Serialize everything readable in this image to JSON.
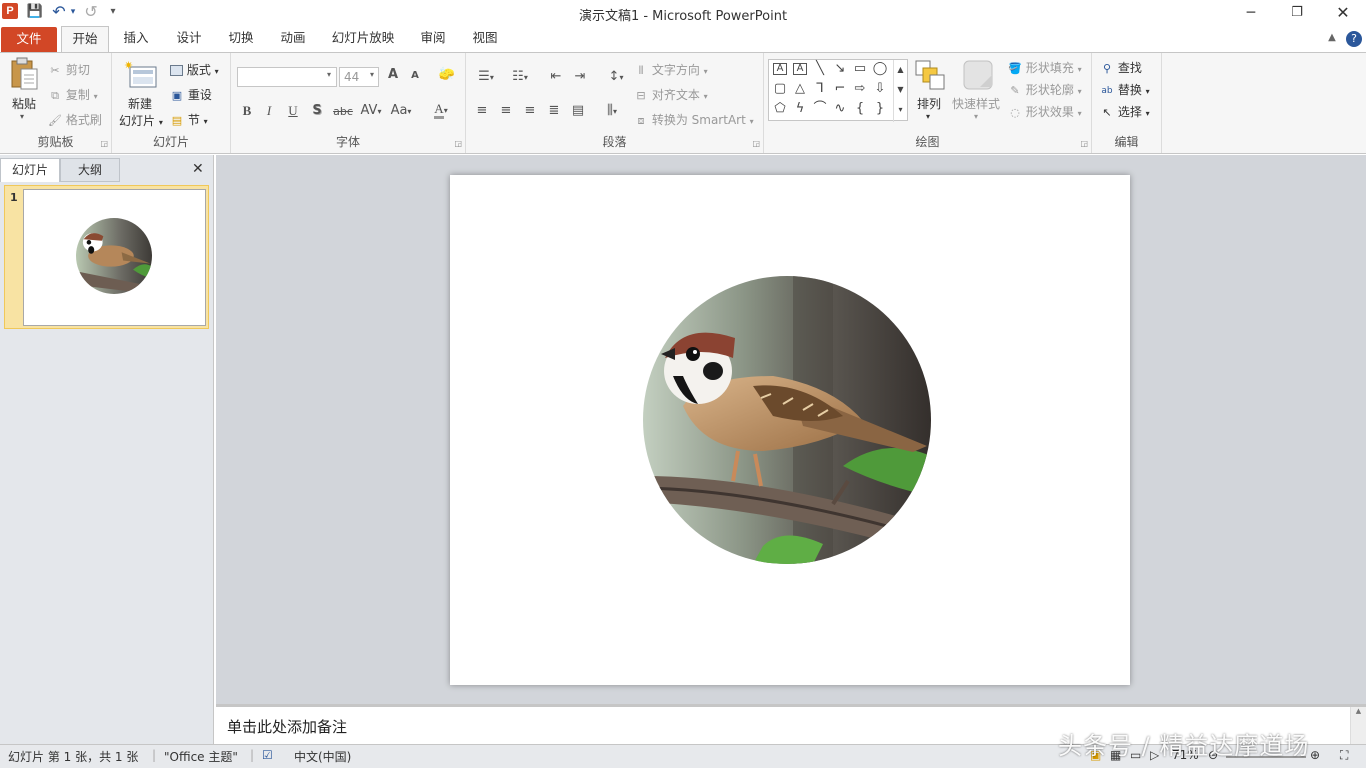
{
  "window": {
    "title": "演示文稿1  -  Microsoft PowerPoint"
  },
  "quick_access": {
    "app_icon_letter": "P",
    "save": "💾",
    "undo": "↶",
    "redo": "↺",
    "customize": "▾"
  },
  "tabs": [
    "文件",
    "开始",
    "插入",
    "设计",
    "切换",
    "动画",
    "幻灯片放映",
    "审阅",
    "视图"
  ],
  "ribbon": {
    "clipboard": {
      "label": "剪贴板",
      "paste": "粘贴",
      "cut": "剪切",
      "copy": "复制",
      "format_painter": "格式刷"
    },
    "slides": {
      "label": "幻灯片",
      "new_slide_1": "新建",
      "new_slide_2": "幻灯片",
      "layout": "版式",
      "reset": "重设",
      "section": "节"
    },
    "font": {
      "label": "字体",
      "font_name": "",
      "font_size": "44",
      "bold": "B",
      "italic": "I",
      "underline": "U",
      "shadow": "S",
      "strike": "abc",
      "spacing": "AV",
      "case": "Aa",
      "color": "A",
      "grow": "A",
      "shrink": "A"
    },
    "paragraph": {
      "label": "段落",
      "text_direction": "文字方向",
      "align_text": "对齐文本",
      "smartart": "转换为 SmartArt"
    },
    "drawing": {
      "label": "绘图",
      "arrange": "排列",
      "quick_styles": "快速样式",
      "shape_fill": "形状填充",
      "shape_outline": "形状轮廓",
      "shape_effects": "形状效果"
    },
    "editing": {
      "label": "编辑",
      "find": "查找",
      "replace": "替换",
      "select": "选择"
    }
  },
  "left_panel": {
    "tab_slides": "幻灯片",
    "tab_outline": "大纲",
    "close": "✕",
    "slide_number": "1"
  },
  "notes": {
    "placeholder": "单击此处添加备注"
  },
  "status": {
    "slide_info": "幻灯片 第 1 张，共 1 张",
    "theme": "\"Office 主题\"",
    "language": "中文(中国)",
    "zoom": "71%"
  },
  "watermark": "头条号 / 精益达摩道场",
  "colors": {
    "file_tab": "#d24726",
    "accent": "#2b579a",
    "selection": "#f8e3a3"
  }
}
